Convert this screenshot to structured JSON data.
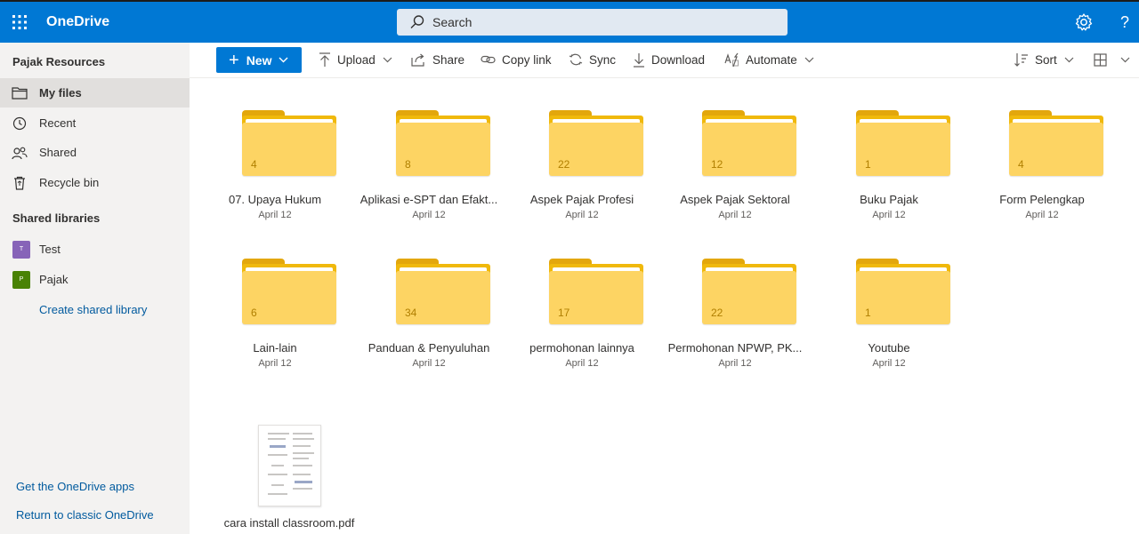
{
  "app": {
    "title": "OneDrive",
    "accent": "#0078d4"
  },
  "search": {
    "placeholder": "Search"
  },
  "sidebar": {
    "user_heading": "Pajak Resources",
    "items": [
      {
        "label": "My files",
        "icon": "folder-icon",
        "active": true
      },
      {
        "label": "Recent",
        "icon": "clock-icon"
      },
      {
        "label": "Shared",
        "icon": "people-icon"
      },
      {
        "label": "Recycle bin",
        "icon": "recycle-bin-icon"
      }
    ],
    "libraries_heading": "Shared libraries",
    "libraries": [
      {
        "label": "Test",
        "initial": "T",
        "color": "#8764b8"
      },
      {
        "label": "Pajak",
        "initial": "P",
        "color": "#498205"
      }
    ],
    "create_library": "Create shared library",
    "get_apps": "Get the OneDrive apps",
    "return_classic": "Return to classic OneDrive"
  },
  "commands": {
    "new": "New",
    "upload": "Upload",
    "share": "Share",
    "copy_link": "Copy link",
    "sync": "Sync",
    "download": "Download",
    "automate": "Automate",
    "sort": "Sort"
  },
  "folders": [
    {
      "name": "07. Upaya Hukum",
      "count": "4",
      "date": "April 12"
    },
    {
      "name": "Aplikasi e-SPT dan Efakt...",
      "count": "8",
      "date": "April 12"
    },
    {
      "name": "Aspek Pajak Profesi",
      "count": "22",
      "date": "April 12"
    },
    {
      "name": "Aspek Pajak Sektoral",
      "count": "12",
      "date": "April 12"
    },
    {
      "name": "Buku Pajak",
      "count": "1",
      "date": "April 12"
    },
    {
      "name": "Form Pelengkap",
      "count": "4",
      "date": "April 12"
    },
    {
      "name": "Lain-lain",
      "count": "6",
      "date": "April 12"
    },
    {
      "name": "Panduan & Penyuluhan",
      "count": "34",
      "date": "April 12"
    },
    {
      "name": "permohonan lainnya",
      "count": "17",
      "date": "April 12"
    },
    {
      "name": "Permohonan NPWP, PK...",
      "count": "22",
      "date": "April 12"
    },
    {
      "name": "Youtube",
      "count": "1",
      "date": "April 12"
    }
  ],
  "files": [
    {
      "name": "cara install classroom.pdf"
    }
  ]
}
